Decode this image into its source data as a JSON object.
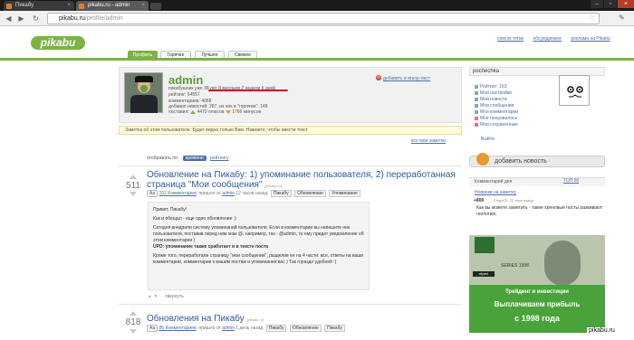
{
  "browser": {
    "tabs": [
      {
        "label": "Пикабу"
      },
      {
        "label": "pikabu.ru - admin"
      }
    ],
    "url_host": "pikabu.ru",
    "url_path": "/profile/admin",
    "window_controls": [
      "minimize-icon",
      "maximize-icon",
      "close-icon"
    ]
  },
  "header": {
    "logo": "pikabu",
    "top_links": [
      "список тегов",
      "обсуждаемое",
      "реклама на Pikabu"
    ],
    "nav_tabs": [
      {
        "label": "Профиль",
        "active": true
      },
      {
        "label": "Горячее",
        "active": false
      },
      {
        "label": "Лучшее",
        "active": false
      },
      {
        "label": "Свежее",
        "active": false
      }
    ],
    "accent_color": "#7cb342"
  },
  "profile": {
    "username": "admin",
    "on_site": "пикабушник уже 38 лет 8 месяцев 2 недели 6 дней",
    "rating": "рейтинг: 64557",
    "comments": "комментариев: 4068",
    "news_added": "добавил новостей: 287, из них в \"горячем\": 148",
    "votes_prefix": "поставил:",
    "votes_plus": "4470 плюсов",
    "votes_minus": "1766 минусов",
    "ignore_link": "добавить в игнор-лист"
  },
  "note_bar": "Заметка об этом пользователе. Будет видна только Вам. Нажмите, чтобы ввести текст",
  "all_notes": "все мои заметки",
  "sort": {
    "label": "отображать по:",
    "time": "времени",
    "rating": "рейтингу"
  },
  "posts": [
    {
      "score": "511",
      "title": "Обновление на Пикабу: 1) упоминание пользователя, 2) переработанная страница \"Мои сообщения\"",
      "source": "[pikabu.ru]",
      "font_btn": "Аа",
      "comments_link": "152 Комментария",
      "posted": ": пришло от",
      "author": "admin",
      "when": "12 часов назад",
      "tags": [
        "Пикабу",
        "Обновление",
        "Упоминание"
      ],
      "body": {
        "greeting": "Привет, Пикабу!",
        "p1": "Как и обещал - еще одно обновление :)",
        "p2": "Сегодня внедрили систему упоминаний пользователя. Если в комментарии вы напишите ник пользователя, поставив перед ним знак @, например, так - @admin, то ему придет уведомление об этом комментарии )",
        "p3": "UPD: упоминание также сработает и в тексте поста",
        "p4": "Кроме того, переработали страницу \"мои сообщения\", разделив ее на 4 части: все, ответы на ваши комментарии, комментарии к вашим постам и упоминания вас ) Так гораздо удобней :)"
      },
      "collapse": "свернуть"
    },
    {
      "score": "818",
      "title": "Обновления на Пикабу",
      "source": "[pikabu.ru]",
      "font_btn": "Аа",
      "comments_link": "85 Комментариев",
      "posted": ": пришло от",
      "author": "admin",
      "when": "1 день назад",
      "tags": [
        "Пикабу",
        "Обновление",
        "Пикабу"
      ]
    }
  ],
  "sidebar": {
    "username": "pochechka",
    "menu": [
      "Рейтинг: 163",
      "Мои настройки",
      "Мои новости",
      "Мои сообщения",
      "Мои комментарии",
      "Мне понравилось",
      "Мои сохраненные",
      "Выйти"
    ],
    "add_news": "добавить новость",
    "comment_day": {
      "title": "Комментарий дня",
      "top50": "ТОП 50",
      "link": "Новинки на заметку",
      "score": "+800",
      "user": "DingoCII, 22 часа назад",
      "text": "Как вы можете заметить - такие хреновые посты развивают геологию."
    },
    "ad": {
      "brand": "elpari",
      "series": "SERIES 1998",
      "line1": "Трейдинг и инвестиции",
      "line2": "Выплачиваем прибыль",
      "line3": "с 1998 года"
    }
  },
  "watermark": "pikabu.ru"
}
